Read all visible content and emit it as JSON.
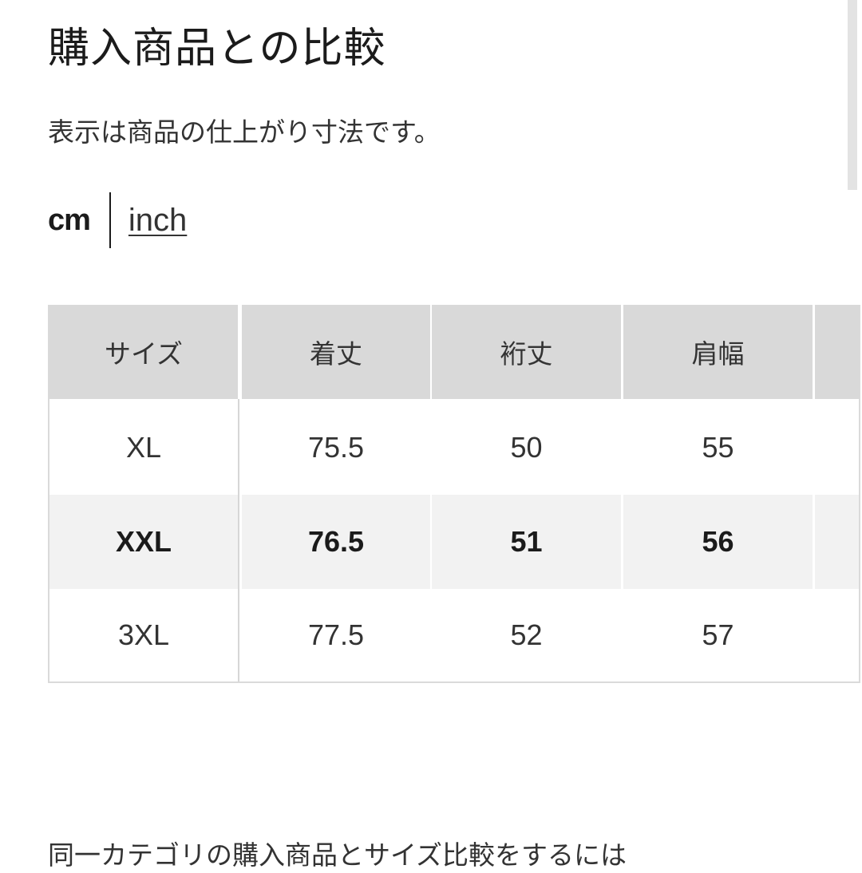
{
  "page": {
    "title": "購入商品との比較",
    "subtitle": "表示は商品の仕上がり寸法です。",
    "footer_text": "同一カテゴリの購入商品とサイズ比較をするには"
  },
  "units": {
    "selected": "cm",
    "cm_label": "cm",
    "inch_label": "inch"
  },
  "size_table": {
    "headers": [
      "サイズ",
      "着丈",
      "裄丈",
      "肩幅",
      ""
    ],
    "rows": [
      {
        "size": "XL",
        "values": [
          "75.5",
          "50",
          "55",
          ""
        ],
        "highlighted": false
      },
      {
        "size": "XXL",
        "values": [
          "76.5",
          "51",
          "56",
          ""
        ],
        "highlighted": true
      },
      {
        "size": "3XL",
        "values": [
          "77.5",
          "52",
          "57",
          ""
        ],
        "highlighted": false
      }
    ]
  },
  "colors": {
    "header_bg": "#d9d9d9",
    "highlight_row_bg": "#f2f2f2",
    "border": "#dadada",
    "text": "#333333"
  }
}
